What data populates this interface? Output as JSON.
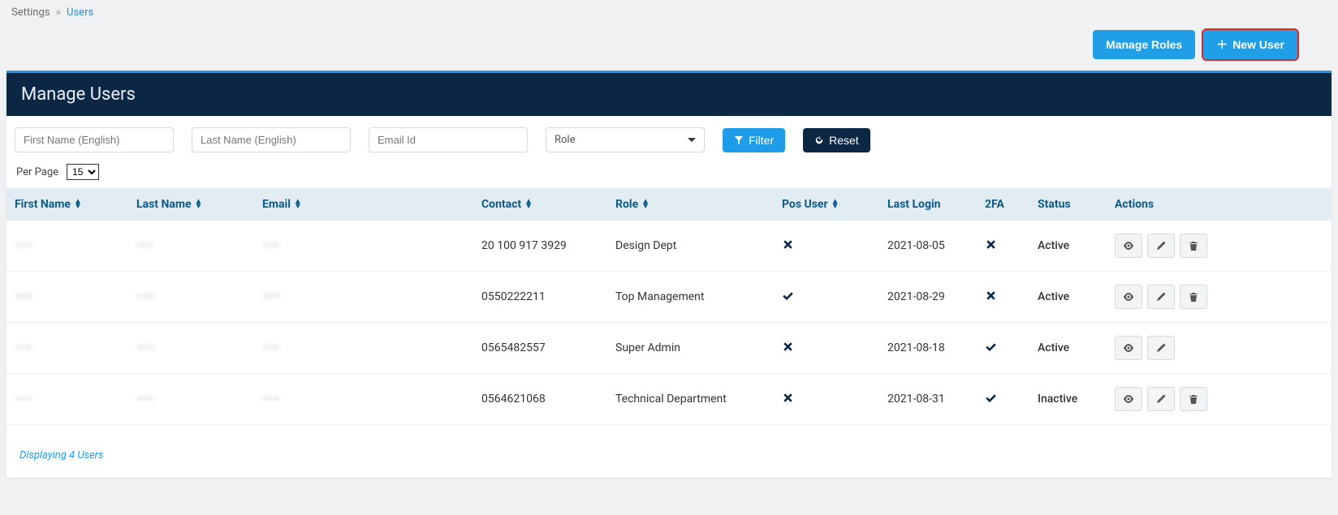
{
  "breadcrumb": {
    "root": "Settings",
    "current": "Users"
  },
  "topActions": {
    "manageRoles": "Manage Roles",
    "newUser": "New User"
  },
  "panel": {
    "title": "Manage Users"
  },
  "filters": {
    "firstNamePlaceholder": "First Name (English)",
    "lastNamePlaceholder": "Last Name (English)",
    "emailPlaceholder": "Email Id",
    "roleLabel": "Role",
    "filterBtn": "Filter",
    "resetBtn": "Reset"
  },
  "perPage": {
    "label": "Per Page",
    "value": "15"
  },
  "columns": {
    "firstName": "First Name",
    "lastName": "Last Name",
    "email": "Email",
    "contact": "Contact",
    "role": "Role",
    "posUser": "Pos User",
    "lastLogin": "Last Login",
    "twoFA": "2FA",
    "status": "Status",
    "actions": "Actions"
  },
  "rows": [
    {
      "firstName": "——",
      "lastName": "——",
      "email": "——",
      "contact": "20 100 917 3929",
      "role": "Design Dept",
      "roleSuper": false,
      "posUser": false,
      "lastLogin": "2021-08-05",
      "twoFA": false,
      "status": "Active",
      "canDelete": true
    },
    {
      "firstName": "——",
      "lastName": "——",
      "email": "——",
      "contact": "0550222211",
      "role": "Top Management",
      "roleSuper": false,
      "posUser": true,
      "lastLogin": "2021-08-29",
      "twoFA": false,
      "status": "Active",
      "canDelete": true
    },
    {
      "firstName": "——",
      "lastName": "——",
      "email": "——",
      "contact": "0565482557",
      "role": "Super Admin",
      "roleSuper": true,
      "posUser": false,
      "lastLogin": "2021-08-18",
      "twoFA": true,
      "status": "Active",
      "canDelete": false
    },
    {
      "firstName": "——",
      "lastName": "——",
      "email": "——",
      "contact": "0564621068",
      "role": "Technical Department",
      "roleSuper": false,
      "posUser": false,
      "lastLogin": "2021-08-31",
      "twoFA": true,
      "status": "Inactive",
      "canDelete": true
    }
  ],
  "footer": {
    "note": "Displaying 4 Users"
  }
}
